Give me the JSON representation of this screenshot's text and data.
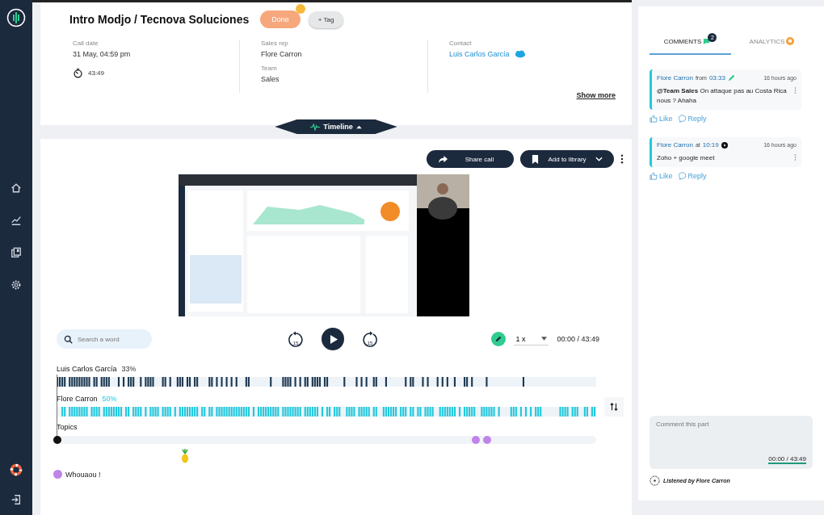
{
  "call": {
    "title": "Intro Modjo / Tecnova Soluciones",
    "status": "Done",
    "tag_button": "+ Tag",
    "show_more": "Show more",
    "timeline_button": "Timeline"
  },
  "details": [
    {
      "kind": "date",
      "label": "Call date",
      "value": "31 May, 04:59 pm",
      "duration": "43:49"
    },
    {
      "kind": "people",
      "label": "Sales rep",
      "value": "Flore Carron",
      "sub_label": "Team",
      "sub_value": "Sales"
    },
    {
      "kind": "contact",
      "label": "Contact",
      "value": "Luis Carlos García"
    }
  ],
  "actions": {
    "share": "Share call",
    "library": "Add to library"
  },
  "player": {
    "search_placeholder": "Search a word",
    "back": "15",
    "forward": "15",
    "speed": "1 x",
    "time": "00:00 / 43:49"
  },
  "speakers": [
    {
      "name": "Luis Carlos García",
      "share": "33%",
      "color": "#1e3a52"
    },
    {
      "name": "Flore Carron",
      "share": "50%",
      "color": "#22c9dc"
    }
  ],
  "topics": {
    "label": "Topics",
    "legend": [
      {
        "label": "Whouaou !",
        "color": "#c084e8"
      }
    ]
  },
  "tabs": [
    {
      "label": "COMMENTS",
      "badge": "2",
      "selected": true
    },
    {
      "label": "ANALYTICS",
      "selected": false
    }
  ],
  "comments": [
    {
      "author": "Flore Carron",
      "link": "from",
      "time": "03:33",
      "kind": "note",
      "ago": "16 hours ago",
      "text": "**@Team Sales** On attaque pas au Costa Rica nous ? Ahaha",
      "like": "Like",
      "reply": "Reply"
    },
    {
      "author": "Flore Carron",
      "link": "at",
      "time": "10:19",
      "kind": "play",
      "ago": "16 hours ago",
      "text": "Zoho + google meet",
      "like": "Like",
      "reply": "Reply"
    }
  ],
  "comment_box": {
    "placeholder": "Comment this part",
    "time": "00:00 / 43:49"
  },
  "listened_by": "Listened by Flore Carron"
}
